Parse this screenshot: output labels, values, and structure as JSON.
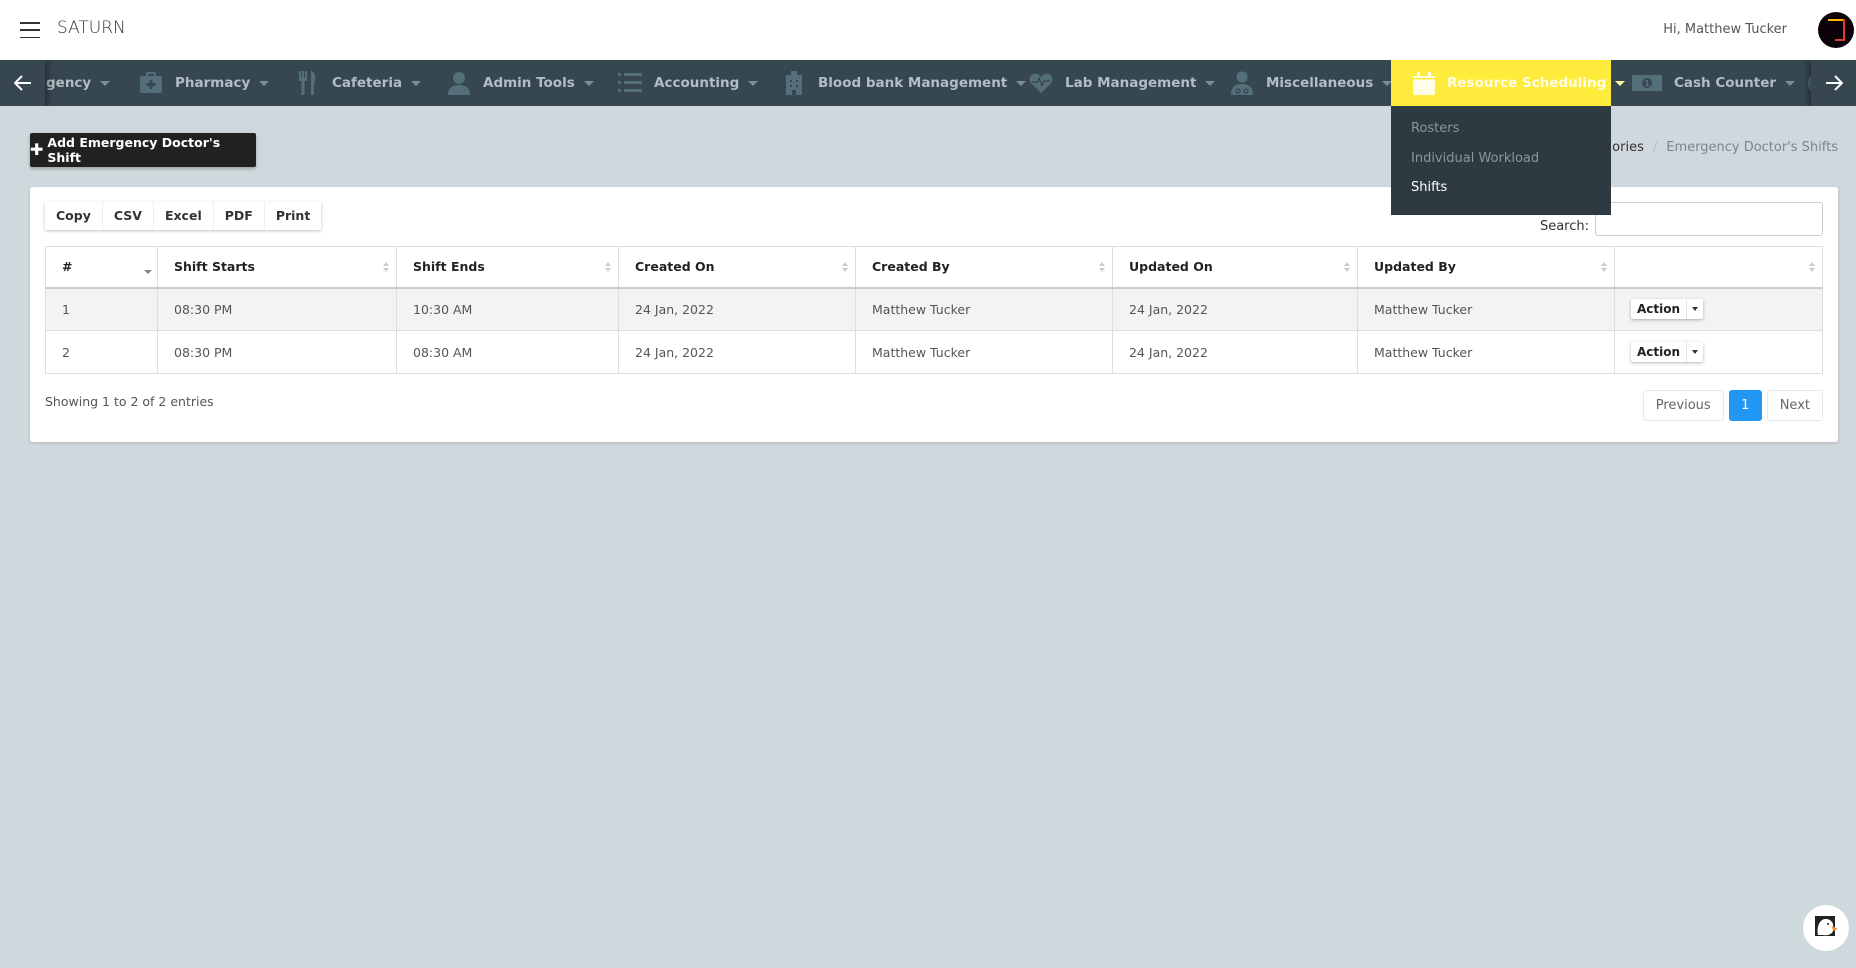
{
  "header": {
    "brand": "SATURN",
    "greeting": "Hi, Matthew Tucker"
  },
  "nav": {
    "items": [
      {
        "label": "gency",
        "icon": "ambulance-icon"
      },
      {
        "label": "Pharmacy",
        "icon": "medkit-icon"
      },
      {
        "label": "Cafeteria",
        "icon": "cutlery-icon"
      },
      {
        "label": "Admin Tools",
        "icon": "user-icon"
      },
      {
        "label": "Accounting",
        "icon": "list-ol-icon"
      },
      {
        "label": "Blood bank Management",
        "icon": "hospital-icon"
      },
      {
        "label": "Lab Management",
        "icon": "heartbeat-icon"
      },
      {
        "label": "Miscellaneous",
        "icon": "user-md-icon"
      },
      {
        "label": "Resource Scheduling",
        "icon": "calendar-icon",
        "active": true
      },
      {
        "label": "Cash Counter",
        "icon": "money-icon"
      }
    ],
    "active_color": "#ffeb3b",
    "bar_color": "#37474f"
  },
  "dropdown": {
    "items": [
      "Rosters",
      "Individual Workload",
      "Shifts"
    ],
    "current": "Shifts"
  },
  "breadcrumb": {
    "parent": "Categories",
    "parent_visible": "tegories",
    "current": "Emergency Doctor's Shifts"
  },
  "add_button": {
    "label": "Add Emergency Doctor's Shift"
  },
  "export_buttons": [
    "Copy",
    "CSV",
    "Excel",
    "PDF",
    "Print"
  ],
  "search": {
    "label": "Search:",
    "value": "",
    "placeholder": ""
  },
  "table": {
    "columns": [
      "#",
      "Shift Starts",
      "Shift Ends",
      "Created On",
      "Created By",
      "Updated On",
      "Updated By",
      ""
    ],
    "rows": [
      {
        "num": "1",
        "shift_starts": "08:30 PM",
        "shift_ends": "10:30 AM",
        "created_on": "24 Jan, 2022",
        "created_by": "Matthew Tucker",
        "updated_on": "24 Jan, 2022",
        "updated_by": "Matthew Tucker",
        "action": "Action"
      },
      {
        "num": "2",
        "shift_starts": "08:30 PM",
        "shift_ends": "08:30 AM",
        "created_on": "24 Jan, 2022",
        "created_by": "Matthew Tucker",
        "updated_on": "24 Jan, 2022",
        "updated_by": "Matthew Tucker",
        "action": "Action"
      }
    ]
  },
  "footer": {
    "info": "Showing 1 to 2 of 2 entries",
    "previous": "Previous",
    "current_page": "1",
    "next": "Next"
  }
}
